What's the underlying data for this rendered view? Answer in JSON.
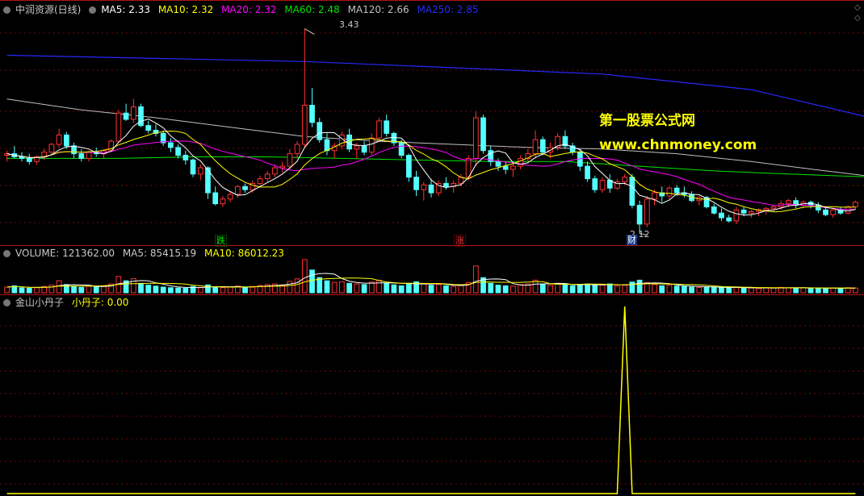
{
  "main_panel": {
    "stock_name": "中润资源(日线)",
    "ma5": "MA5: 2.33",
    "ma10": "MA10: 2.32",
    "ma20": "MA20: 2.32",
    "ma60": "MA60: 2.48",
    "ma120": "MA120: 2.66",
    "ma250": "MA250: 2.85",
    "high_label": "3.43",
    "low_label": "2.12",
    "tag_down": "跌",
    "tag_up": "涨",
    "tag_fin": "财"
  },
  "volume_panel": {
    "volume": "VOLUME: 121362.00",
    "ma5": "MA5: 85415.19",
    "ma10": "MA10: 86012.23"
  },
  "indicator_panel": {
    "name": "金山小丹子",
    "value": "小丹子: 0.00"
  },
  "watermark": {
    "line1": "第一股票公式网",
    "line2": "www.chnmoney.com"
  },
  "colors": {
    "up": "#ff3232",
    "down": "#54ffff",
    "ma5": "#ffffff",
    "ma10": "#ffff00",
    "ma20": "#ff00ff",
    "ma60": "#00e600",
    "ma120": "#c0c0c0",
    "ma250": "#2828ff",
    "indicator": "#ffff00"
  },
  "chart_data": {
    "type": "candlestick",
    "price_range": [
      2.05,
      3.5
    ],
    "candles": [
      [
        2.62,
        2.65,
        2.58,
        2.63
      ],
      [
        2.63,
        2.68,
        2.6,
        2.61
      ],
      [
        2.61,
        2.64,
        2.58,
        2.6
      ],
      [
        2.6,
        2.63,
        2.56,
        2.58
      ],
      [
        2.58,
        2.62,
        2.56,
        2.61
      ],
      [
        2.61,
        2.66,
        2.59,
        2.64
      ],
      [
        2.64,
        2.7,
        2.62,
        2.69
      ],
      [
        2.69,
        2.79,
        2.67,
        2.75
      ],
      [
        2.75,
        2.77,
        2.66,
        2.68
      ],
      [
        2.68,
        2.7,
        2.6,
        2.63
      ],
      [
        2.63,
        2.66,
        2.58,
        2.6
      ],
      [
        2.6,
        2.65,
        2.58,
        2.64
      ],
      [
        2.64,
        2.67,
        2.61,
        2.63
      ],
      [
        2.63,
        2.66,
        2.6,
        2.65
      ],
      [
        2.65,
        2.72,
        2.64,
        2.71
      ],
      [
        2.71,
        2.91,
        2.7,
        2.89
      ],
      [
        2.89,
        2.95,
        2.84,
        2.85
      ],
      [
        2.85,
        2.98,
        2.83,
        2.93
      ],
      [
        2.93,
        2.95,
        2.8,
        2.81
      ],
      [
        2.81,
        2.84,
        2.76,
        2.78
      ],
      [
        2.78,
        2.82,
        2.74,
        2.76
      ],
      [
        2.76,
        2.78,
        2.68,
        2.7
      ],
      [
        2.7,
        2.73,
        2.64,
        2.67
      ],
      [
        2.67,
        2.69,
        2.6,
        2.62
      ],
      [
        2.62,
        2.65,
        2.56,
        2.59
      ],
      [
        2.59,
        2.6,
        2.48,
        2.5
      ],
      [
        2.5,
        2.56,
        2.46,
        2.54
      ],
      [
        2.54,
        2.55,
        2.34,
        2.38
      ],
      [
        2.38,
        2.42,
        2.3,
        2.31
      ],
      [
        2.31,
        2.36,
        2.29,
        2.34
      ],
      [
        2.34,
        2.39,
        2.32,
        2.37
      ],
      [
        2.37,
        2.43,
        2.35,
        2.42
      ],
      [
        2.42,
        2.44,
        2.38,
        2.4
      ],
      [
        2.4,
        2.46,
        2.38,
        2.44
      ],
      [
        2.44,
        2.49,
        2.42,
        2.47
      ],
      [
        2.47,
        2.52,
        2.45,
        2.5
      ],
      [
        2.5,
        2.56,
        2.48,
        2.54
      ],
      [
        2.54,
        2.58,
        2.51,
        2.55
      ],
      [
        2.55,
        2.66,
        2.53,
        2.63
      ],
      [
        2.63,
        2.71,
        2.6,
        2.69
      ],
      [
        2.69,
        3.43,
        2.67,
        2.94
      ],
      [
        2.94,
        3.05,
        2.8,
        2.83
      ],
      [
        2.83,
        2.86,
        2.7,
        2.72
      ],
      [
        2.72,
        2.76,
        2.62,
        2.65
      ],
      [
        2.65,
        2.7,
        2.6,
        2.68
      ],
      [
        2.68,
        2.77,
        2.66,
        2.75
      ],
      [
        2.75,
        2.79,
        2.64,
        2.66
      ],
      [
        2.66,
        2.7,
        2.6,
        2.68
      ],
      [
        2.68,
        2.71,
        2.62,
        2.64
      ],
      [
        2.64,
        2.76,
        2.62,
        2.73
      ],
      [
        2.73,
        2.86,
        2.72,
        2.84
      ],
      [
        2.84,
        2.88,
        2.74,
        2.76
      ],
      [
        2.76,
        2.77,
        2.68,
        2.7
      ],
      [
        2.7,
        2.72,
        2.6,
        2.62
      ],
      [
        2.62,
        2.63,
        2.45,
        2.48
      ],
      [
        2.48,
        2.52,
        2.36,
        2.4
      ],
      [
        2.4,
        2.45,
        2.33,
        2.43
      ],
      [
        2.43,
        2.47,
        2.35,
        2.38
      ],
      [
        2.38,
        2.46,
        2.36,
        2.44
      ],
      [
        2.44,
        2.48,
        2.4,
        2.42
      ],
      [
        2.42,
        2.46,
        2.38,
        2.44
      ],
      [
        2.44,
        2.5,
        2.42,
        2.48
      ],
      [
        2.48,
        2.62,
        2.46,
        2.6
      ],
      [
        2.6,
        2.9,
        2.55,
        2.86
      ],
      [
        2.86,
        2.88,
        2.63,
        2.65
      ],
      [
        2.65,
        2.68,
        2.55,
        2.58
      ],
      [
        2.58,
        2.6,
        2.52,
        2.55
      ],
      [
        2.55,
        2.58,
        2.5,
        2.53
      ],
      [
        2.53,
        2.57,
        2.48,
        2.55
      ],
      [
        2.55,
        2.62,
        2.53,
        2.6
      ],
      [
        2.6,
        2.66,
        2.58,
        2.63
      ],
      [
        2.63,
        2.78,
        2.6,
        2.72
      ],
      [
        2.72,
        2.74,
        2.62,
        2.64
      ],
      [
        2.64,
        2.7,
        2.6,
        2.67
      ],
      [
        2.67,
        2.76,
        2.65,
        2.74
      ],
      [
        2.74,
        2.78,
        2.66,
        2.68
      ],
      [
        2.68,
        2.7,
        2.62,
        2.64
      ],
      [
        2.64,
        2.66,
        2.52,
        2.55
      ],
      [
        2.55,
        2.58,
        2.45,
        2.47
      ],
      [
        2.47,
        2.49,
        2.38,
        2.4
      ],
      [
        2.4,
        2.48,
        2.38,
        2.46
      ],
      [
        2.46,
        2.5,
        2.38,
        2.41
      ],
      [
        2.41,
        2.47,
        2.4,
        2.45
      ],
      [
        2.45,
        2.5,
        2.43,
        2.48
      ],
      [
        2.48,
        2.5,
        2.28,
        2.3
      ],
      [
        2.3,
        2.33,
        2.12,
        2.18
      ],
      [
        2.18,
        2.36,
        2.16,
        2.34
      ],
      [
        2.34,
        2.4,
        2.3,
        2.38
      ],
      [
        2.38,
        2.42,
        2.32,
        2.36
      ],
      [
        2.36,
        2.42,
        2.34,
        2.41
      ],
      [
        2.41,
        2.43,
        2.36,
        2.38
      ],
      [
        2.38,
        2.42,
        2.35,
        2.37
      ],
      [
        2.37,
        2.39,
        2.32,
        2.33
      ],
      [
        2.33,
        2.36,
        2.3,
        2.35
      ],
      [
        2.35,
        2.36,
        2.28,
        2.29
      ],
      [
        2.29,
        2.31,
        2.24,
        2.25
      ],
      [
        2.25,
        2.28,
        2.2,
        2.22
      ],
      [
        2.22,
        2.24,
        2.19,
        2.2
      ],
      [
        2.2,
        2.29,
        2.18,
        2.27
      ],
      [
        2.27,
        2.29,
        2.23,
        2.25
      ],
      [
        2.25,
        2.27,
        2.22,
        2.26
      ],
      [
        2.26,
        2.28,
        2.23,
        2.27
      ],
      [
        2.27,
        2.29,
        2.24,
        2.28
      ],
      [
        2.28,
        2.3,
        2.26,
        2.29
      ],
      [
        2.29,
        2.33,
        2.27,
        2.31
      ],
      [
        2.31,
        2.34,
        2.29,
        2.33
      ],
      [
        2.33,
        2.35,
        2.28,
        2.3
      ],
      [
        2.3,
        2.33,
        2.28,
        2.32
      ],
      [
        2.32,
        2.33,
        2.28,
        2.3
      ],
      [
        2.3,
        2.32,
        2.25,
        2.27
      ],
      [
        2.27,
        2.29,
        2.23,
        2.24
      ],
      [
        2.24,
        2.28,
        2.22,
        2.27
      ],
      [
        2.27,
        2.29,
        2.24,
        2.25
      ],
      [
        2.25,
        2.3,
        2.24,
        2.29
      ],
      [
        2.29,
        2.33,
        2.27,
        2.32
      ]
    ],
    "volume": [
      18,
      22,
      15,
      14,
      16,
      20,
      24,
      38,
      26,
      20,
      17,
      21,
      19,
      22,
      28,
      52,
      38,
      45,
      30,
      24,
      21,
      18,
      16,
      15,
      14,
      20,
      17,
      25,
      19,
      16,
      18,
      21,
      17,
      20,
      23,
      26,
      28,
      25,
      36,
      44,
      105,
      72,
      48,
      38,
      33,
      35,
      30,
      28,
      26,
      34,
      40,
      30,
      25,
      22,
      30,
      35,
      28,
      24,
      26,
      22,
      20,
      23,
      32,
      85,
      48,
      30,
      24,
      22,
      21,
      26,
      28,
      40,
      26,
      24,
      30,
      27,
      22,
      24,
      28,
      26,
      25,
      28,
      22,
      24,
      34,
      40,
      32,
      26,
      22,
      24,
      21,
      20,
      18,
      17,
      19,
      18,
      16,
      15,
      17,
      16,
      15,
      14,
      16,
      15,
      17,
      16,
      15,
      16,
      14,
      15,
      14,
      15,
      14,
      16,
      15
    ],
    "indicator": {
      "name": "小丹子",
      "peak_index": 83,
      "peak_value": 1,
      "base_value": 0
    },
    "ma_long": {
      "ma120": [
        [
          0,
          2.98
        ],
        [
          10,
          2.91
        ],
        [
          20,
          2.86
        ],
        [
          30,
          2.8
        ],
        [
          40,
          2.74
        ],
        [
          50,
          2.71
        ],
        [
          60,
          2.69
        ],
        [
          70,
          2.67
        ],
        [
          80,
          2.66
        ],
        [
          90,
          2.63
        ],
        [
          100,
          2.58
        ],
        [
          110,
          2.52
        ],
        [
          117,
          2.48
        ]
      ],
      "ma250": [
        [
          0,
          3.26
        ],
        [
          20,
          3.24
        ],
        [
          40,
          3.22
        ],
        [
          60,
          3.18
        ],
        [
          80,
          3.14
        ],
        [
          100,
          3.04
        ],
        [
          117,
          2.85
        ]
      ],
      "ma60": [
        [
          0,
          2.6
        ],
        [
          15,
          2.6
        ],
        [
          25,
          2.61
        ],
        [
          35,
          2.61
        ],
        [
          45,
          2.6
        ],
        [
          55,
          2.59
        ],
        [
          65,
          2.58
        ],
        [
          75,
          2.58
        ],
        [
          85,
          2.55
        ],
        [
          95,
          2.52
        ],
        [
          105,
          2.5
        ],
        [
          117,
          2.48
        ]
      ]
    }
  }
}
